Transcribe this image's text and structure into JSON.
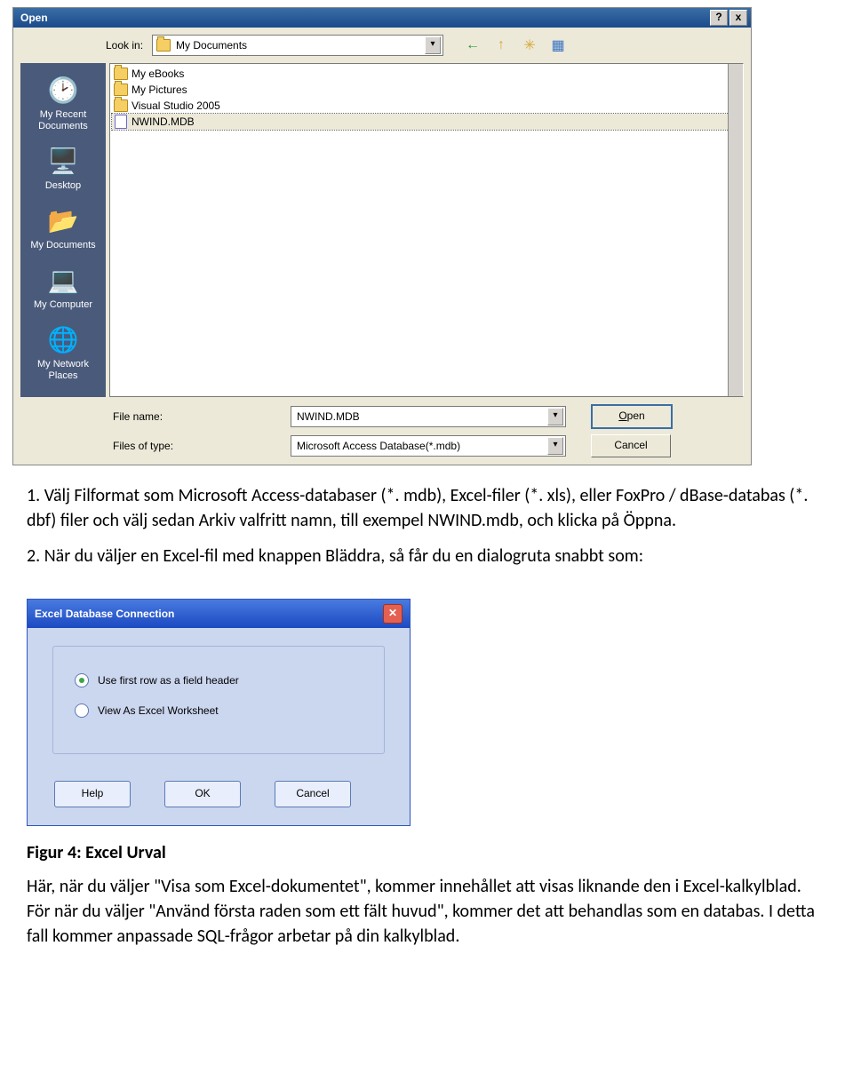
{
  "open_dialog": {
    "title": "Open",
    "help_btn": "?",
    "close_btn": "x",
    "look_in_label": "Look in:",
    "look_in_value": "My Documents",
    "toolbar": {
      "back": "←",
      "up": "↑",
      "new_folder": "✳",
      "views": "▦"
    },
    "places": [
      {
        "label": "My Recent Documents"
      },
      {
        "label": "Desktop"
      },
      {
        "label": "My Documents"
      },
      {
        "label": "My Computer"
      },
      {
        "label": "My Network Places"
      }
    ],
    "files": [
      {
        "name": "My eBooks",
        "type": "folder"
      },
      {
        "name": "My Pictures",
        "type": "folder"
      },
      {
        "name": "Visual Studio 2005",
        "type": "folder"
      },
      {
        "name": "NWIND.MDB",
        "type": "file",
        "selected": true
      }
    ],
    "file_name_label": "File name:",
    "file_name_value": "NWIND.MDB",
    "file_type_label": "Files of type:",
    "file_type_value": "Microsoft Access Database(*.mdb)",
    "open_btn": "Open",
    "cancel_btn": "Cancel"
  },
  "doc": {
    "para1": "1. Välj Filformat som Microsoft Access-databaser (*. mdb), Excel-filer (*. xls), eller FoxPro / dBase-databas (*. dbf) filer och välj sedan Arkiv valfritt namn, till exempel NWIND.mdb, och klicka på Öppna.",
    "para2": "2. När du väljer en Excel-fil med knappen Bläddra, så får du en dialogruta snabbt som:",
    "caption": "Figur 4: Excel Urval",
    "para3": "Här, när du väljer \"Visa som Excel-dokumentet\", kommer innehållet att visas liknande den i Excel-kalkylblad. För när du väljer \"Använd första raden som ett fält huvud\", kommer det att behandlas som en databas. I detta fall kommer anpassade SQL-frågor arbetar på din kalkylblad."
  },
  "excel_dialog": {
    "title": "Excel Database Connection",
    "opt1": "Use first row as a field header",
    "opt2": "View As Excel Worksheet",
    "help_btn": "Help",
    "ok_btn": "OK",
    "cancel_btn": "Cancel"
  }
}
